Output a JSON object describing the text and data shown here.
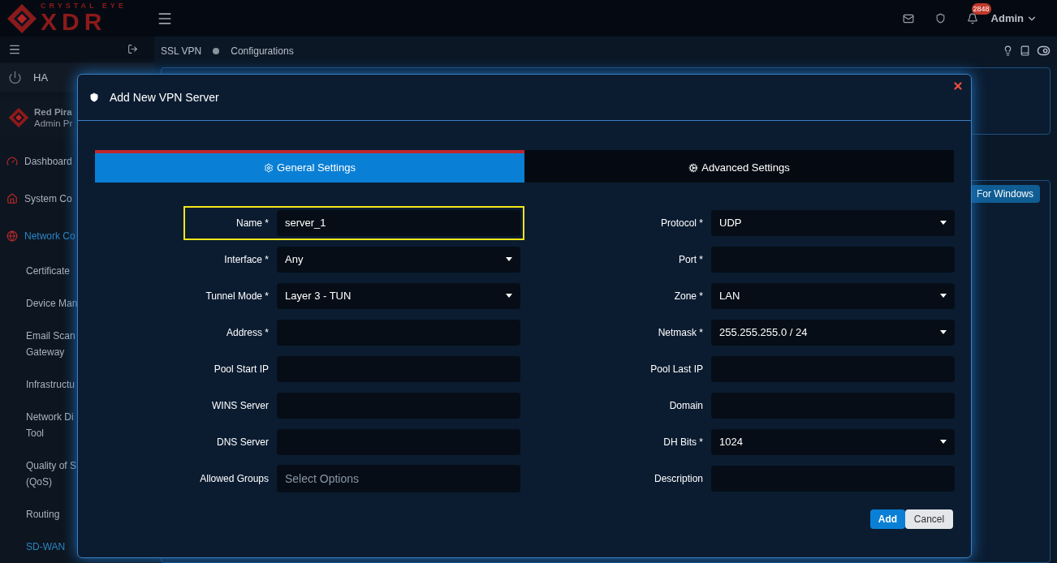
{
  "header": {
    "logo_top": "CRYSTAL EYE",
    "logo_main": "XDR",
    "notification_count": "2848",
    "user": "Admin"
  },
  "breadcrumb": [
    "SSL VPN",
    "Configurations"
  ],
  "sidebar": {
    "ha": "HA",
    "profile": {
      "name": "Red Pira",
      "role": "Admin Pr"
    },
    "items": [
      {
        "kind": "main",
        "label": [
          "Dashboard"
        ],
        "active": false
      },
      {
        "kind": "main",
        "label": [
          "System Co"
        ],
        "active": false
      },
      {
        "kind": "main",
        "label": [
          "Network Co"
        ],
        "active": true
      },
      {
        "kind": "sub",
        "label": [
          "Certificate"
        ],
        "active": false
      },
      {
        "kind": "sub",
        "label": [
          "Device Man"
        ],
        "active": false
      },
      {
        "kind": "sub",
        "label": [
          "Email Scan",
          "Gateway"
        ],
        "active": false
      },
      {
        "kind": "sub",
        "label": [
          "Infrastructu"
        ],
        "active": false
      },
      {
        "kind": "sub",
        "label": [
          "Network Di",
          "Tool"
        ],
        "active": false
      },
      {
        "kind": "sub",
        "label": [
          "Quality of S",
          "(QoS)"
        ],
        "active": false
      },
      {
        "kind": "sub",
        "label": [
          "Routing"
        ],
        "active": false
      },
      {
        "kind": "sub",
        "label": [
          "SD-WAN"
        ],
        "active": true
      }
    ]
  },
  "page": {
    "download_button": "For Windows"
  },
  "modal": {
    "title": "Add New VPN Server",
    "tabs": [
      {
        "label": "General Settings",
        "selected": true
      },
      {
        "label": "Advanced Settings",
        "selected": false
      }
    ],
    "left_fields": [
      {
        "label": "Name *",
        "kind": "text",
        "value": "server_1",
        "highlighted": true
      },
      {
        "label": "Interface *",
        "kind": "select",
        "value": "Any",
        "highlighted": false
      },
      {
        "label": "Tunnel Mode *",
        "kind": "select",
        "value": "Layer 3 - TUN",
        "highlighted": false
      },
      {
        "label": "Address *",
        "kind": "text",
        "highlighted": false
      },
      {
        "label": "Pool Start IP",
        "kind": "text",
        "highlighted": false
      },
      {
        "label": "WINS Server",
        "kind": "text",
        "highlighted": false
      },
      {
        "label": "DNS Server",
        "kind": "text",
        "highlighted": false
      },
      {
        "label": "Allowed Groups",
        "kind": "multiselect",
        "placeholder": "Select Options",
        "highlighted": false
      }
    ],
    "right_fields": [
      {
        "label": "Protocol *",
        "kind": "select",
        "value": "UDP",
        "highlighted": false
      },
      {
        "label": "Port *",
        "kind": "text",
        "highlighted": false
      },
      {
        "label": "Zone *",
        "kind": "select",
        "value": "LAN",
        "highlighted": false
      },
      {
        "label": "Netmask *",
        "kind": "select",
        "value": "255.255.255.0 / 24",
        "highlighted": false
      },
      {
        "label": "Pool Last IP",
        "kind": "text",
        "highlighted": false
      },
      {
        "label": "Domain",
        "kind": "text",
        "highlighted": false
      },
      {
        "label": "DH Bits *",
        "kind": "select",
        "value": "1024",
        "highlighted": false
      },
      {
        "label": "Description",
        "kind": "text",
        "highlighted": false
      }
    ],
    "buttons": {
      "primary": "Add",
      "secondary": "Cancel"
    }
  }
}
